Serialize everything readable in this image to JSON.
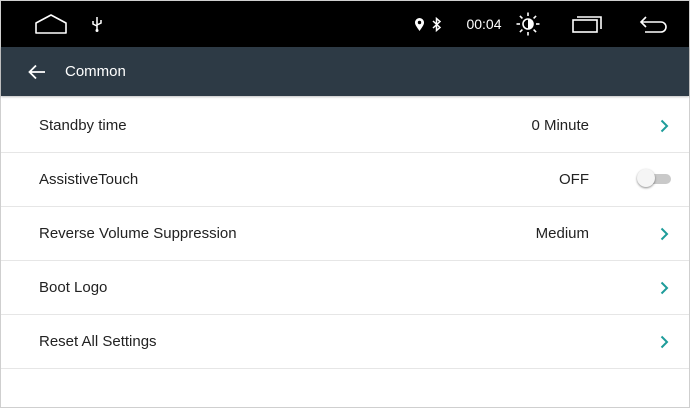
{
  "status_bar": {
    "icons": [
      "home-icon",
      "usb-icon",
      "location-icon",
      "bluetooth-icon",
      "brightness-icon",
      "recent-apps-icon",
      "back-icon"
    ],
    "time": "00:04"
  },
  "header": {
    "title": "Common",
    "back_icon": "arrow-left-icon"
  },
  "settings": [
    {
      "label": "Standby time",
      "value": "0 Minute",
      "control": "chevron"
    },
    {
      "label": "AssistiveTouch",
      "value": "OFF",
      "control": "toggle",
      "toggle_on": false
    },
    {
      "label": "Reverse Volume Suppression",
      "value": "Medium",
      "control": "chevron"
    },
    {
      "label": "Boot Logo",
      "value": "",
      "control": "chevron"
    },
    {
      "label": "Reset All Settings",
      "value": "",
      "control": "chevron"
    }
  ],
  "colors": {
    "status_bar_bg": "#000000",
    "title_bar_bg": "#2d3a45",
    "chevron_accent": "#1e9c9a",
    "divider": "#e6e6e6"
  }
}
